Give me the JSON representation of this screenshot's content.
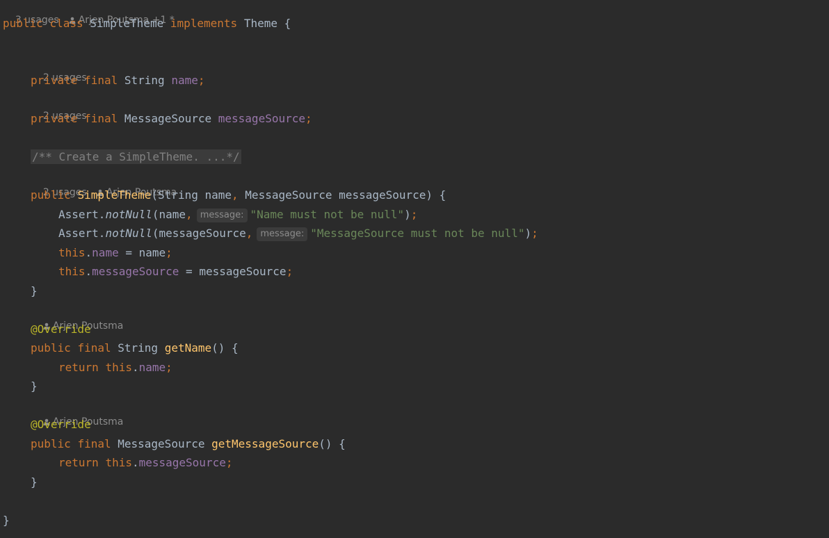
{
  "code_vision": {
    "class_usages": "3 usages",
    "class_author": "Arjen Poutsma +1 *",
    "name_usages": "2 usages",
    "messageSource_usages": "2 usages",
    "constructor_usages": "2 usages",
    "constructor_author": "Arjen Poutsma",
    "getName_author": "Arjen Poutsma",
    "getMessageSource_author": "Arjen Poutsma"
  },
  "code": {
    "kw_public": "public",
    "kw_class": "class",
    "kw_implements": "implements",
    "kw_private": "private",
    "kw_final": "final",
    "kw_this": "this",
    "kw_return": "return",
    "class_name": "SimpleTheme",
    "interface_name": "Theme",
    "type_string": "String",
    "type_message_source": "MessageSource",
    "field_name": "name",
    "field_message_source": "messageSource",
    "folded_comment": "/** Create a SimpleTheme. ...*/",
    "assert_class": "Assert",
    "not_null_method": "notNull",
    "param_hint_label": "message:",
    "msg_name_null": "\"Name must not be null\"",
    "msg_source_null": "\"MessageSource must not be null\"",
    "annotation_override": "@Override",
    "method_get_name": "getName",
    "method_get_message_source": "getMessageSource"
  },
  "icons": {
    "author": "user-icon"
  },
  "colors": {
    "background": "#2b2b2b",
    "keyword": "#cc7832",
    "field": "#9876aa",
    "method": "#ffc66d",
    "string": "#6a8759",
    "annotation": "#bbb529",
    "hint": "#8c8c8c"
  }
}
